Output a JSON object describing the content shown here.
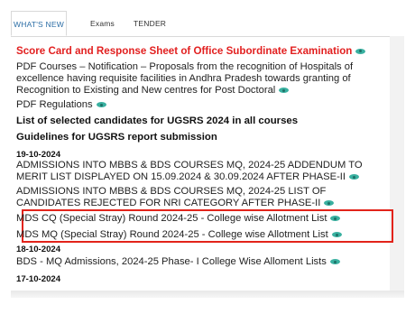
{
  "tabs": {
    "whats_new": "WHAT'S NEW",
    "exams": "Exams",
    "tender": "TENDER"
  },
  "items": {
    "i1": "Score Card and Response Sheet of Office Subordinate Examination",
    "i2": "PDF Courses – Notification – Proposals from the recognition of Hospitals of excellence having requisite facilities in Andhra Pradesh towards granting of Recognition to Existing and New centres for Post Doctoral",
    "i3": "PDF Regulations",
    "i4": "List of selected candidates for UGSRS 2024 in all courses",
    "i5": "Guidelines for UGSRS report submission",
    "d1": "19-10-2024",
    "i6": "ADMISSIONS INTO MBBS & BDS COURSES MQ, 2024-25 ADDENDUM TO MERIT LIST DISPLAYED ON 15.09.2024 & 30.09.2024 AFTER PHASE-II",
    "i7": "ADMISSIONS INTO MBBS & BDS COURSES MQ, 2024-25 LIST OF CANDIDATES REJECTED FOR NRI CATEGORY AFTER PHASE-II",
    "i8": "MDS CQ (Special Stray) Round 2024-25 - College wise Allotment List",
    "i9": "MDS MQ (Special Stray) Round 2024-25 - College wise Allotment List",
    "d2": "18-10-2024",
    "i10": "BDS - MQ Admissions, 2024-25 Phase- I College Wise Alloment Lists",
    "d3": "17-10-2024"
  },
  "colors": {
    "accent_red": "#e22020",
    "tab_blue": "#2c6ea6",
    "eye_teal": "#39b0a0"
  }
}
